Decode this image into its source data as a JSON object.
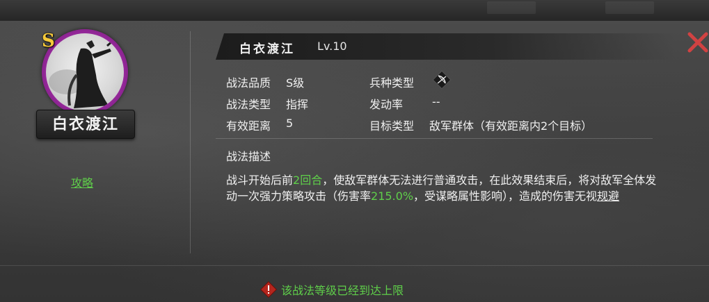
{
  "skill": {
    "name": "白衣渡江",
    "level": "Lv.10",
    "grade_badge": "S",
    "portrait_name": "白衣渡江",
    "guide_link": "攻略"
  },
  "attributes": {
    "quality_label": "战法品质",
    "quality_value": "S级",
    "type_label": "战法类型",
    "type_value": "指挥",
    "range_label": "有效距离",
    "range_value": "5",
    "troop_label": "兵种类型",
    "troop_icon": "bow-icon",
    "trigger_label": "发动率",
    "trigger_value": "--",
    "target_label": "目标类型",
    "target_value": "敌军群体（有效距离内2个目标）"
  },
  "description": {
    "heading": "战法描述",
    "part1": "战斗开始后前",
    "highlight1": "2回合",
    "part2": "，使敌军群体无法进行普通攻击，在此效果结束后，将对敌军全体发动一次强力策略攻击（伤害率",
    "highlight2": "215.0%",
    "part3": "，受谋略属性影响），造成的伤害无视",
    "underlined": "规避"
  },
  "notice": {
    "text": "该战法等级已经到达上限"
  },
  "colors": {
    "highlight_green": "#5fcf4a",
    "close_red": "#d14242",
    "grade_gold": "#f5c93a",
    "portrait_ring": "#9b2aa0"
  }
}
